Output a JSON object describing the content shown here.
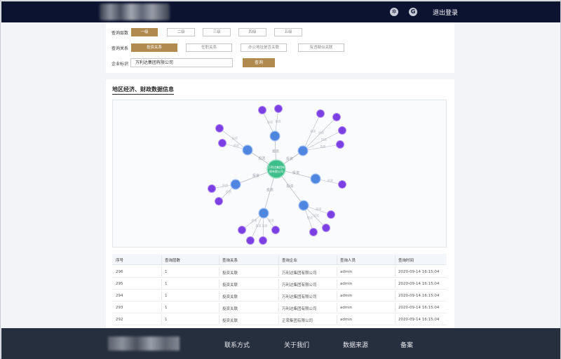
{
  "header": {
    "logout_label": "退出登录",
    "icons": [
      "settings-icon",
      "google-icon"
    ]
  },
  "query": {
    "level_label": "查询层数",
    "levels": [
      "一级",
      "二级",
      "三级",
      "四级",
      "五级"
    ],
    "active_level": "一级",
    "relation_label": "查询关系",
    "relations": [
      "投资关系",
      "任职关系",
      "办公地址是否关联",
      "有违疑似关联"
    ],
    "active_relation": "投资关系",
    "company_label": "企业标识",
    "company_value": "万利达集团有限公司",
    "search_label": "查询"
  },
  "section": {
    "title": "地区经济、财政数据信息"
  },
  "graph": {
    "center_label_line1": "万利达集团有",
    "center_label_line2": "限有限公司",
    "edge_label": "投资",
    "colors": {
      "center": "#3dbe8a",
      "mid": "#4f86e0",
      "leaf": "#7b3fe4",
      "edge": "#b8bcc4"
    }
  },
  "table": {
    "columns": [
      "序号",
      "查询层数",
      "查询关系",
      "查询企业",
      "查询人员",
      "查询时间"
    ],
    "rows": [
      [
        "296",
        "1",
        "投资关联",
        "万利达集团有限公司",
        "admin",
        "2020-09-14   16:15:04"
      ],
      [
        "295",
        "1",
        "投资关联",
        "万利达集团有限公司",
        "admin",
        "2020-09-14   16:15:04"
      ],
      [
        "294",
        "1",
        "投资关联",
        "万利达集团有限公司",
        "admin",
        "2020-09-14   16:15:04"
      ],
      [
        "293",
        "1",
        "投资关联",
        "万利达集团有限公司",
        "admin",
        "2020-09-14   16:15:04"
      ],
      [
        "292",
        "1",
        "投资关联",
        "正荣集团有限公司",
        "admin",
        "2020-09-14   16:15:04"
      ]
    ]
  },
  "footer": {
    "links": [
      "联系方式",
      "关于我们",
      "数据来源",
      "备案"
    ]
  }
}
